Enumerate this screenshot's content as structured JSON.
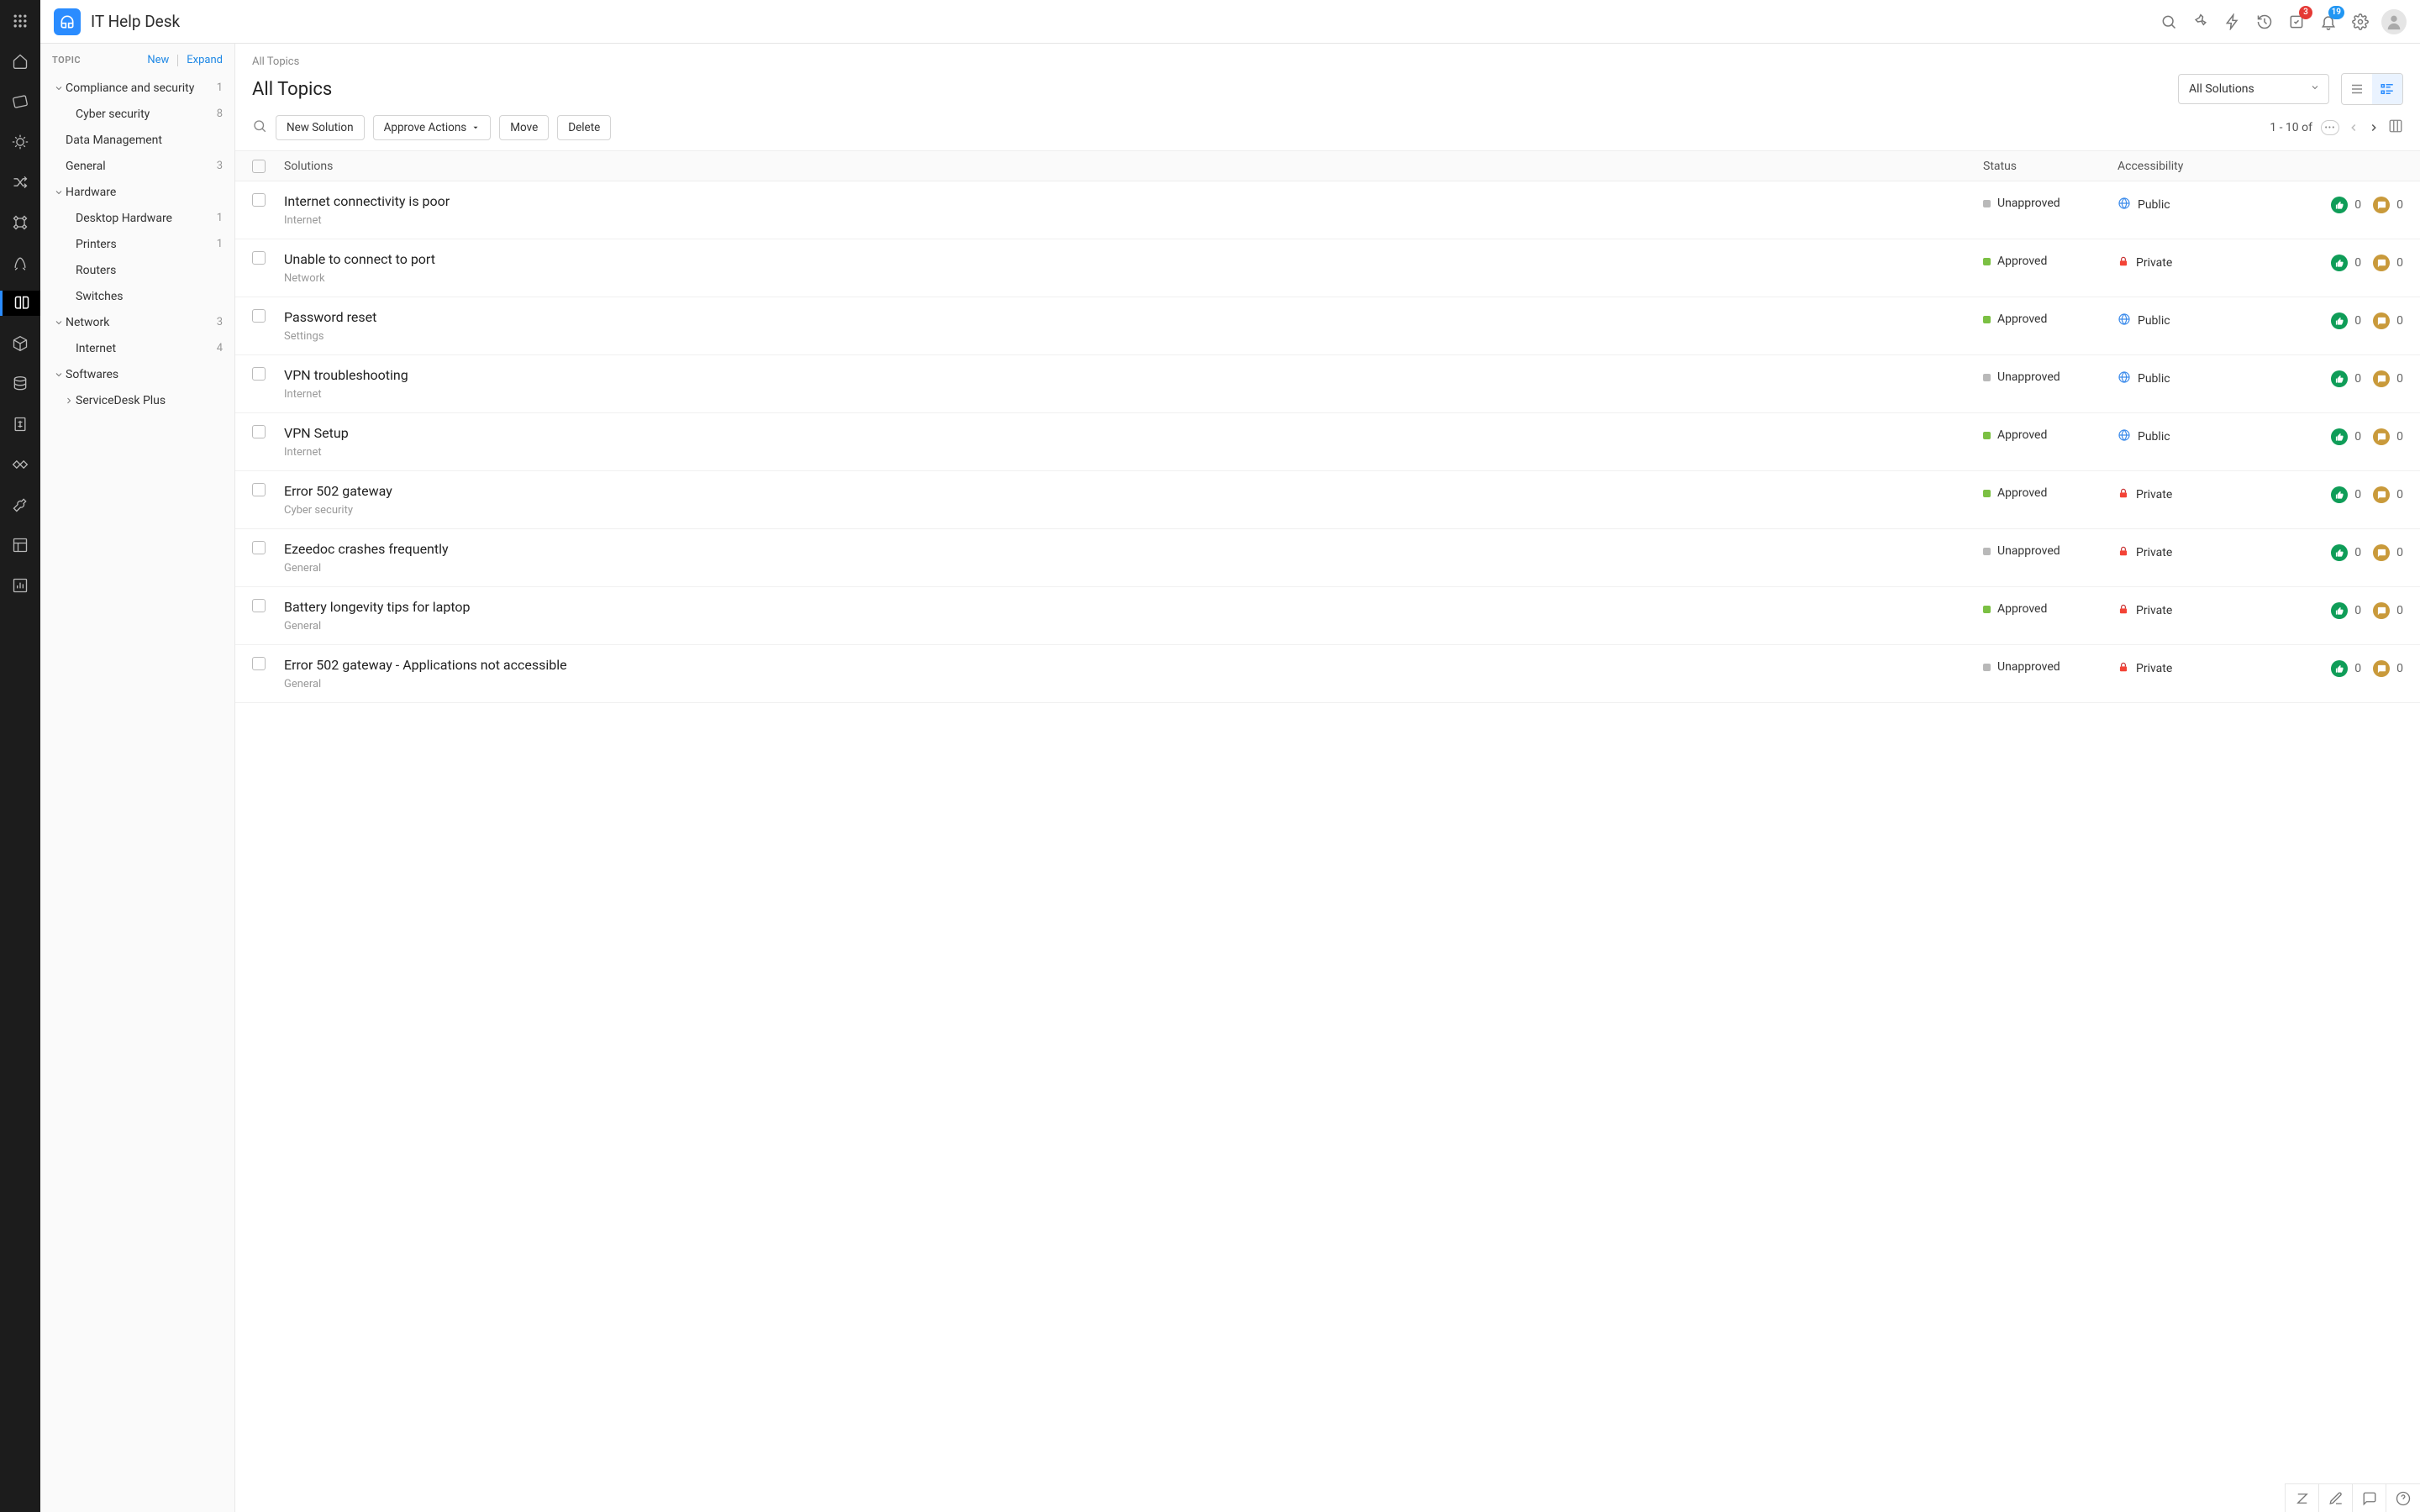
{
  "app": {
    "title": "IT Help Desk"
  },
  "topbar": {
    "pending_badge": "3",
    "notifications_badge": "19"
  },
  "sidebar": {
    "heading": "TOPIC",
    "new": "New",
    "expand": "Expand",
    "tree": [
      {
        "label": "Compliance and security",
        "count": "1",
        "level": 0,
        "expandable": true,
        "expanded": true
      },
      {
        "label": "Cyber security",
        "count": "8",
        "level": 1
      },
      {
        "label": "Data Management",
        "count": "",
        "level": 0,
        "expandable": false
      },
      {
        "label": "General",
        "count": "3",
        "level": 0,
        "expandable": false
      },
      {
        "label": "Hardware",
        "count": "",
        "level": 0,
        "expandable": true,
        "expanded": true
      },
      {
        "label": "Desktop Hardware",
        "count": "1",
        "level": 1
      },
      {
        "label": "Printers",
        "count": "1",
        "level": 1
      },
      {
        "label": "Routers",
        "count": "",
        "level": 1
      },
      {
        "label": "Switches",
        "count": "",
        "level": 1
      },
      {
        "label": "Network",
        "count": "3",
        "level": 0,
        "expandable": true,
        "expanded": true
      },
      {
        "label": "Internet",
        "count": "4",
        "level": 1
      },
      {
        "label": "Softwares",
        "count": "",
        "level": 0,
        "expandable": true,
        "expanded": true
      },
      {
        "label": "ServiceDesk Plus",
        "count": "",
        "level": 1,
        "expandable": true,
        "expanded": false
      }
    ]
  },
  "content": {
    "breadcrumb": "All Topics",
    "heading": "All Topics",
    "filter_dropdown": "All Solutions",
    "toolbar": {
      "new_solution": "New Solution",
      "approve_actions": "Approve Actions",
      "move": "Move",
      "delete": "Delete"
    },
    "pager_text": "1 - 10 of",
    "columns": {
      "solutions": "Solutions",
      "status": "Status",
      "accessibility": "Accessibility"
    },
    "rows": [
      {
        "title": "Internet connectivity is poor",
        "category": "Internet",
        "status": "Unapproved",
        "accessibility": "Public",
        "likes": "0",
        "comments": "0"
      },
      {
        "title": "Unable to connect to port",
        "category": "Network",
        "status": "Approved",
        "accessibility": "Private",
        "likes": "0",
        "comments": "0"
      },
      {
        "title": "Password reset",
        "category": "Settings",
        "status": "Approved",
        "accessibility": "Public",
        "likes": "0",
        "comments": "0"
      },
      {
        "title": "VPN troubleshooting",
        "category": "Internet",
        "status": "Unapproved",
        "accessibility": "Public",
        "likes": "0",
        "comments": "0"
      },
      {
        "title": "VPN Setup",
        "category": "Internet",
        "status": "Approved",
        "accessibility": "Public",
        "likes": "0",
        "comments": "0"
      },
      {
        "title": "Error 502 gateway",
        "category": "Cyber security",
        "status": "Approved",
        "accessibility": "Private",
        "likes": "0",
        "comments": "0"
      },
      {
        "title": "Ezeedoc crashes frequently",
        "category": "General",
        "status": "Unapproved",
        "accessibility": "Private",
        "likes": "0",
        "comments": "0"
      },
      {
        "title": "Battery longevity tips for laptop",
        "category": "General",
        "status": "Approved",
        "accessibility": "Private",
        "likes": "0",
        "comments": "0"
      },
      {
        "title": "Error 502 gateway - Applications not accessible",
        "category": "General",
        "status": "Unapproved",
        "accessibility": "Private",
        "likes": "0",
        "comments": "0"
      }
    ]
  }
}
